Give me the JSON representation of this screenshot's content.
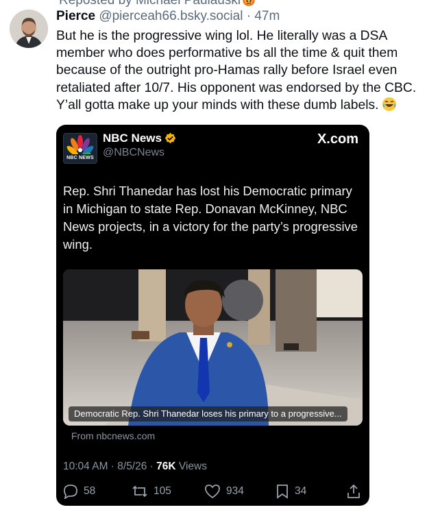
{
  "repost": {
    "label": "Reposted by Michael Paulauski"
  },
  "post": {
    "author_name": "Pierce",
    "author_handle": "@pierceah66.bsky.social",
    "separator": "·",
    "age": "47m",
    "text": "But he is the progressive wing lol. He literally was a DSA\nmember who does performative bs all the time & quit them\nbecause of the outright pro-Hamas rally before Israel even\nretaliated after 10/7. His opponent was endorsed by the CBC.\nY’all gotta make up your minds with these dumb labels."
  },
  "embed": {
    "account_name": "NBC News",
    "account_handle": "@NBCNews",
    "logo_text": "NBC NEWS",
    "source_site": "X.com",
    "text": "Rep. Shri Thanedar has lost his Democratic primary in Michigan to state Rep. Donavan McKinney, NBC News projects, in a victory for the party’s progressive wing.",
    "link_caption": "Democratic Rep. Shri Thanedar loses his primary to a progressive...",
    "link_domain": "From nbcnews.com",
    "timestamp": "10:04 AM · 8/5/26 ·",
    "views_count": "76K",
    "views_label": "Views",
    "replies": "58",
    "reposts": "105",
    "likes": "934",
    "bookmarks": "34"
  },
  "icons": [
    "repost-icon",
    "verified-badge-icon",
    "reply-icon",
    "retweet-icon",
    "like-icon",
    "bookmark-icon",
    "share-icon",
    "laughing-emoji-icon",
    "nbc-peacock-icon"
  ],
  "colors": {
    "card_bg": "#000000",
    "verified": "#f4b400",
    "muted_text": "#5b6b7b"
  }
}
